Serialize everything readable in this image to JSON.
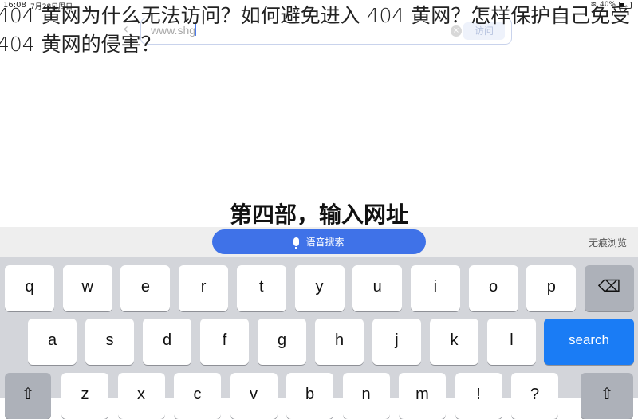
{
  "status_bar": {
    "time": "16:08",
    "date": "7月28日周日",
    "battery": "40%",
    "battery_level": 0.4
  },
  "headline": "404 黄网为什么无法访问？如何避免进入 404 黄网？怎样保护自己免受 404 黄网的侵害？",
  "browser": {
    "back_icon": "chevron-left-icon",
    "url_value": "www.shg",
    "clear_icon": "clear-icon",
    "visit_label": "访问"
  },
  "caption": "第四部，输入网址",
  "toolbar": {
    "voice_search_label": "语音搜索",
    "mic_icon": "microphone-icon",
    "incognito_label": "无痕浏览"
  },
  "keyboard": {
    "row1": [
      "q",
      "w",
      "e",
      "r",
      "t",
      "y",
      "u",
      "i",
      "o",
      "p"
    ],
    "row2": [
      "a",
      "s",
      "d",
      "f",
      "g",
      "h",
      "j",
      "k",
      "l"
    ],
    "row3": [
      "z",
      "x",
      "c",
      "v",
      "b",
      "n",
      "m",
      "!",
      "?"
    ],
    "search_label": "search",
    "backspace_icon": "backspace-icon",
    "shift_icon": "shift-icon"
  },
  "colors": {
    "accent": "#3f72e8",
    "search_key": "#1a7cf5",
    "keyboard_bg": "#d3d5da"
  }
}
